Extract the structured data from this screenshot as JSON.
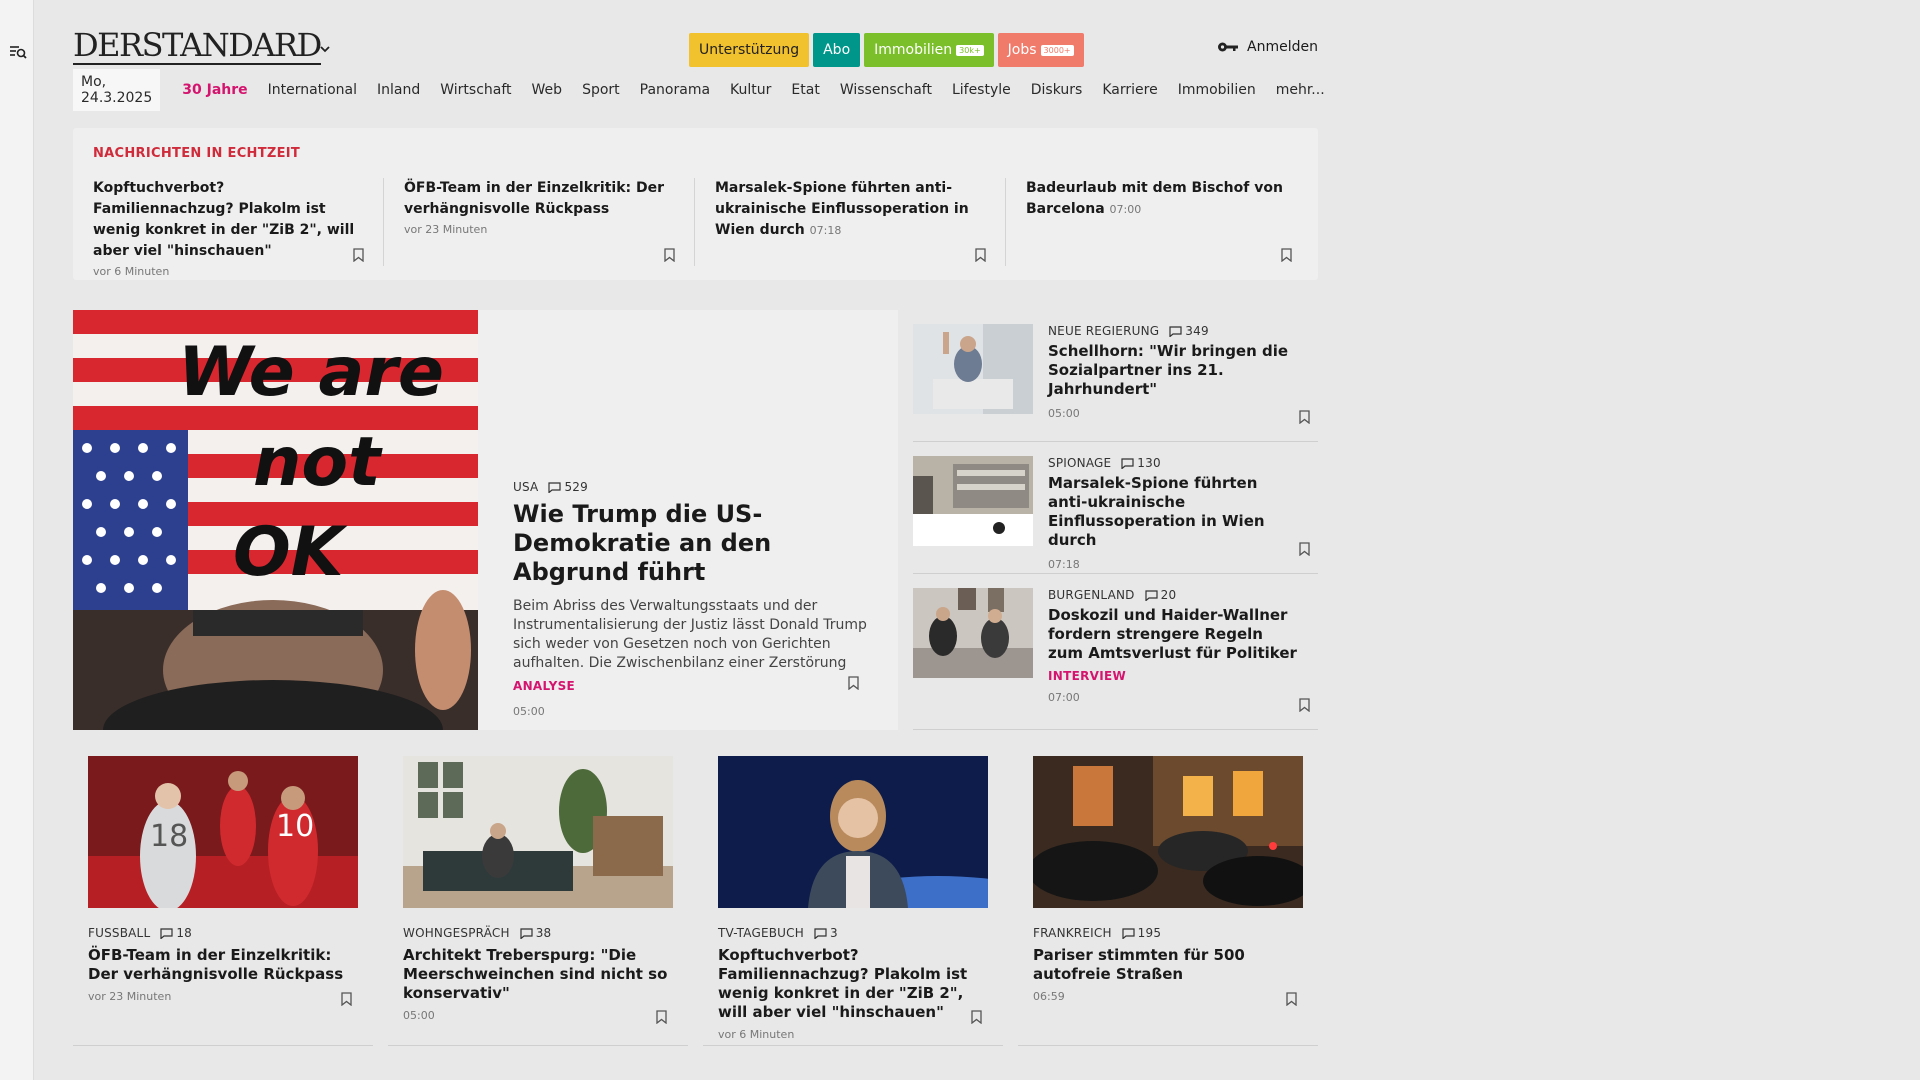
{
  "header": {
    "logo": "DERSTANDARD",
    "pills": {
      "support": "Unterstützung",
      "abo": "Abo",
      "immo": "Immobilien",
      "immo_badge": "30k+",
      "jobs": "Jobs",
      "jobs_badge": "3000+"
    },
    "login": "Anmelden"
  },
  "nav": {
    "date": "Mo, 24.3.2025",
    "items": [
      "30 Jahre",
      "International",
      "Inland",
      "Wirtschaft",
      "Web",
      "Sport",
      "Panorama",
      "Kultur",
      "Etat",
      "Wissenschaft",
      "Lifestyle",
      "Diskurs",
      "Karriere",
      "Immobilien",
      "mehr..."
    ]
  },
  "live": {
    "title": "NACHRICHTEN IN ECHTZEIT",
    "items": [
      {
        "headline": "Kopftuchverbot? Familiennachzug? Plakolm ist wenig konkret in der \"ZiB 2\", will aber viel \"hinschauen\"",
        "time": "vor 6 Minuten"
      },
      {
        "headline": "ÖFB-Team in der Einzelkritik: Der verhängnisvolle Rückpass",
        "time": "vor 23 Minuten"
      },
      {
        "headline": "Marsalek-Spione führten anti-ukrainische Einflussoperation in Wien durch",
        "time": "07:18"
      },
      {
        "headline": "Badeurlaub mit dem Bischof von Barcelona",
        "time": "07:00"
      }
    ]
  },
  "feature": {
    "kicker": "USA",
    "comments": "529",
    "headline": "Wie Trump die US-Demokratie an den Abgrund führt",
    "lead": "Beim Abriss des Verwaltungsstaats und der Instrumentalisierung der Justiz lässt Donald Trump sich weder von Gesetzen noch von Gerichten aufhalten. Die Zwischenbilanz einer Zerstörung",
    "tag": "ANALYSE",
    "time": "05:00",
    "sign_text": "We are not OK"
  },
  "side": [
    {
      "kicker": "NEUE REGIERUNG",
      "comments": "349",
      "headline": "Schellhorn: \"Wir bringen die Sozialpartner ins 21. Jahrhundert\"",
      "time": "05:00",
      "tag": ""
    },
    {
      "kicker": "SPIONAGE",
      "comments": "130",
      "headline": "Marsalek-Spione führten anti-ukrainische Einflussoperation in Wien durch",
      "time": "07:18",
      "tag": ""
    },
    {
      "kicker": "BURGENLAND",
      "comments": "20",
      "headline": "Doskozil und Haider-Wallner fordern strengere Regeln zum Amtsverlust für Politiker",
      "time": "07:00",
      "tag": "INTERVIEW"
    }
  ],
  "cards": [
    {
      "kicker": "FUSSBALL",
      "comments": "18",
      "headline": "ÖFB-Team in der Einzelkritik: Der verhängnisvolle Rückpass",
      "time": "vor 23 Minuten"
    },
    {
      "kicker": "WOHNGESPRÄCH",
      "comments": "38",
      "headline": "Architekt Treberspurg: \"Die Meerschweinchen sind nicht so konservativ\"",
      "time": "05:00"
    },
    {
      "kicker": "TV-TAGEBUCH",
      "comments": "3",
      "headline": "Kopftuchverbot? Familiennachzug? Plakolm ist wenig konkret in der \"ZiB 2\", will aber viel \"hinschauen\"",
      "time": "vor 6 Minuten"
    },
    {
      "kicker": "FRANKREICH",
      "comments": "195",
      "headline": "Pariser stimmten für 500 autofreie Straßen",
      "time": "06:59"
    }
  ],
  "colors": {
    "accent": "#d4146e",
    "live_red": "#cf2b3a",
    "abo": "#00968a",
    "support": "#f2c12e",
    "immo": "#7bbf2a",
    "jobs": "#f07b6b"
  }
}
